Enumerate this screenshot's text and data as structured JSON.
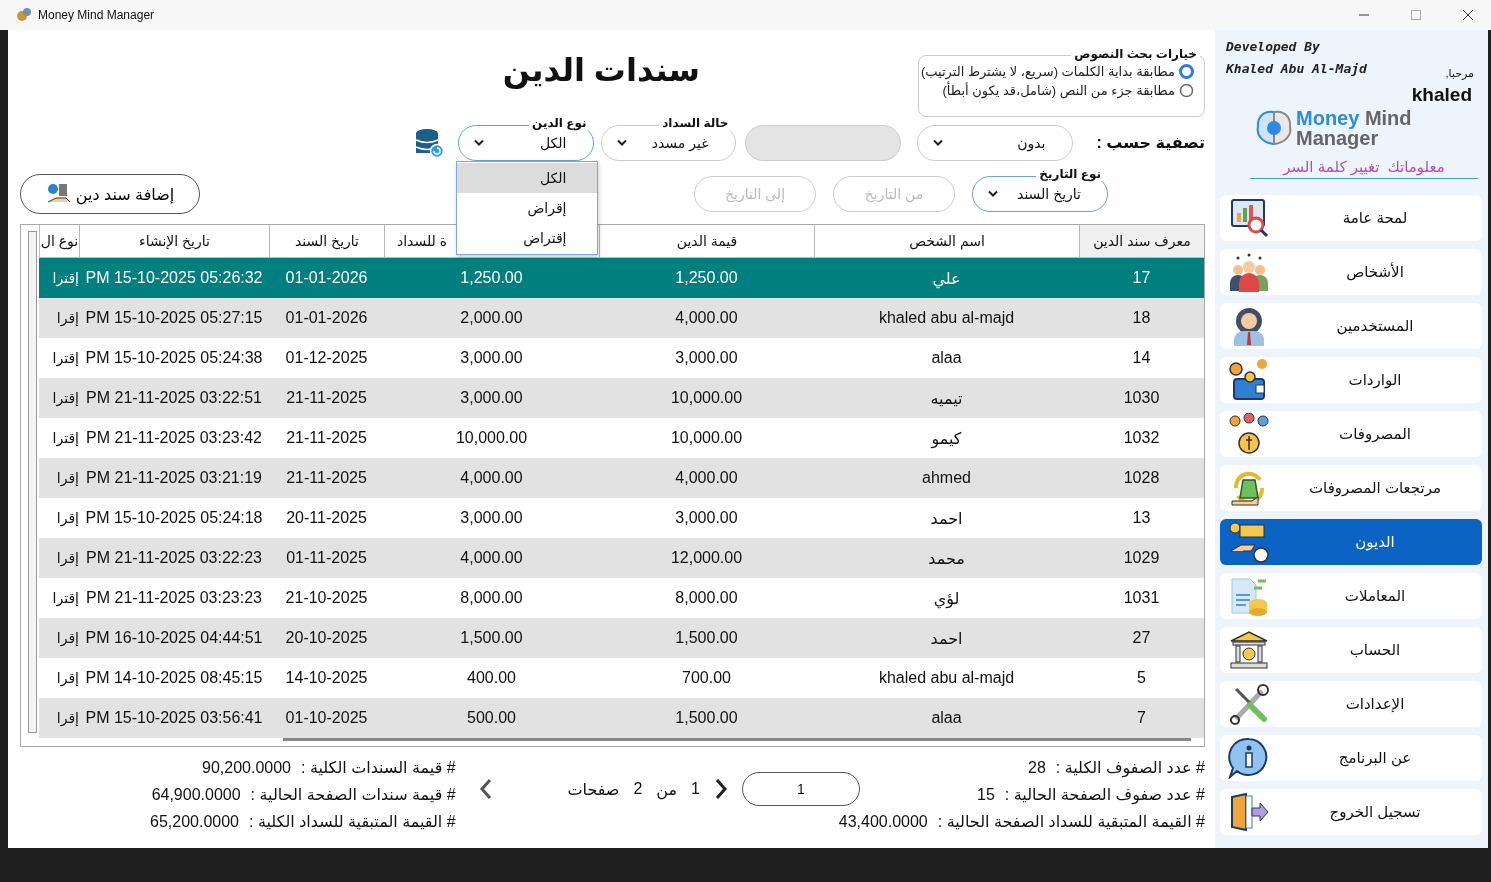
{
  "window": {
    "title": "Money Mind Manager"
  },
  "page_title": "سندات الدين",
  "search_options": {
    "legend": "خيارات بحث النصوص",
    "options": [
      {
        "label": "مطابقة بداية الكلمات (سريع، لا يشترط الترتيب)",
        "selected": true
      },
      {
        "label": "مطابقة جزء من النص (شامل،قد يكون أبطأ)",
        "selected": false
      }
    ]
  },
  "filter": {
    "label": "تصفية حسب :",
    "by": "بدون",
    "text_field": {
      "disabled": true
    }
  },
  "payment_status": {
    "legend": "حالة السداد",
    "value": "غير مسدد"
  },
  "debt_type": {
    "legend": "نوع الدين",
    "value": "الكل",
    "expanded": true,
    "options": [
      {
        "label": "الكل",
        "selected": true
      },
      {
        "label": "إقراض",
        "selected": false
      },
      {
        "label": "إقتراض",
        "selected": false
      }
    ]
  },
  "date_type": {
    "legend": "نوع التاريخ",
    "value": "تاريخ السند"
  },
  "from_date": {
    "placeholder": "من التاريخ"
  },
  "to_date": {
    "placeholder": "إلى التاريخ"
  },
  "add_button": "إضافة سند دين",
  "table": {
    "columns": [
      "معرف سند الدين",
      "اسم الشخص",
      "قيمة الدين",
      "ة للسداد",
      "تاريخ السند",
      "تاريخ الإنشاء",
      "نوع ال"
    ],
    "rows": [
      {
        "selected": true,
        "cells": [
          "17",
          "علي",
          "1,250.00",
          "1,250.00",
          "01-01-2026",
          "PM 15-10-2025 05:26:32",
          "إقترا"
        ]
      },
      {
        "selected": false,
        "cells": [
          "18",
          "khaled abu al-majd",
          "4,000.00",
          "2,000.00",
          "01-01-2026",
          "PM 15-10-2025 05:27:15",
          "إقرا"
        ]
      },
      {
        "selected": false,
        "cells": [
          "14",
          "alaa",
          "3,000.00",
          "3,000.00",
          "01-12-2025",
          "PM 15-10-2025 05:24:38",
          "إقترا"
        ]
      },
      {
        "selected": false,
        "cells": [
          "1030",
          "تيميه",
          "10,000.00",
          "3,000.00",
          "21-11-2025",
          "PM 21-11-2025 03:22:51",
          "إقترا"
        ]
      },
      {
        "selected": false,
        "cells": [
          "1032",
          "كيمو",
          "10,000.00",
          "10,000.00",
          "21-11-2025",
          "PM 21-11-2025 03:23:42",
          "إقترا"
        ]
      },
      {
        "selected": false,
        "cells": [
          "1028",
          "ahmed",
          "4,000.00",
          "4,000.00",
          "21-11-2025",
          "PM 21-11-2025 03:21:19",
          "إقرا"
        ]
      },
      {
        "selected": false,
        "cells": [
          "13",
          "احمد",
          "3,000.00",
          "3,000.00",
          "20-11-2025",
          "PM 15-10-2025 05:24:18",
          "إقرا"
        ]
      },
      {
        "selected": false,
        "cells": [
          "1029",
          "محمد",
          "12,000.00",
          "4,000.00",
          "01-11-2025",
          "PM 21-11-2025 03:22:23",
          "إقرا"
        ]
      },
      {
        "selected": false,
        "cells": [
          "1031",
          "لؤي",
          "8,000.00",
          "8,000.00",
          "21-10-2025",
          "PM 21-11-2025 03:23:23",
          "إقترا"
        ]
      },
      {
        "selected": false,
        "cells": [
          "27",
          "احمد",
          "1,500.00",
          "1,500.00",
          "20-10-2025",
          "PM 16-10-2025 04:44:51",
          "إقرا"
        ]
      },
      {
        "selected": false,
        "cells": [
          "5",
          "khaled abu al-majd",
          "700.00",
          "400.00",
          "14-10-2025",
          "PM 14-10-2025 08:45:15",
          "إقرا"
        ]
      },
      {
        "selected": false,
        "cells": [
          "7",
          "alaa",
          "1,500.00",
          "500.00",
          "01-10-2025",
          "PM 15-10-2025 03:56:41",
          "إقرا"
        ]
      }
    ]
  },
  "footer": {
    "right": [
      {
        "label": "# عدد الصفوف الكلية :",
        "value": "28"
      },
      {
        "label": "# عدد صفوف الصفحة الحالية :",
        "value": "15"
      },
      {
        "label": "# القيمة المتبقية للسداد الصفحة الحالية :",
        "value": "43,400.0000"
      }
    ],
    "pager": {
      "page_input": "1",
      "current": "1",
      "of": "من",
      "total": "2",
      "pages": "صفحات"
    },
    "left": [
      {
        "label": "# قيمة السندات الكلية :",
        "value": "90,200.0000"
      },
      {
        "label": "# قيمة سندات الصفحة الحالية :",
        "value": "64,900.0000"
      },
      {
        "label": "# القيمة المتبقية للسداد الكلية :",
        "value": "65,200.0000"
      }
    ]
  },
  "sidebar": {
    "developer": [
      "Developed By",
      "Khaled Abu Al-Majd"
    ],
    "greeting": "مرحبا,",
    "user": "khaled",
    "logo": {
      "accent": "Money",
      "word": "Mind",
      "subtitle": "Manager"
    },
    "links": [
      "معلوماتك",
      "تغيير كلمة السر"
    ],
    "items": [
      {
        "label": "لمحة عامة",
        "selected": false
      },
      {
        "label": "الأشخاص",
        "selected": false
      },
      {
        "label": "المستخدمين",
        "selected": false
      },
      {
        "label": "الواردات",
        "selected": false
      },
      {
        "label": "المصروفات",
        "selected": false
      },
      {
        "label": "مرتجعات المصروفات",
        "selected": false
      },
      {
        "label": "الديون",
        "selected": true
      },
      {
        "label": "المعاملات",
        "selected": false
      },
      {
        "label": "الحساب",
        "selected": false
      },
      {
        "label": "الإعدادات",
        "selected": false
      },
      {
        "label": "عن البرنامج",
        "selected": false
      },
      {
        "label": "تسجيل الخروج",
        "selected": false
      }
    ]
  }
}
